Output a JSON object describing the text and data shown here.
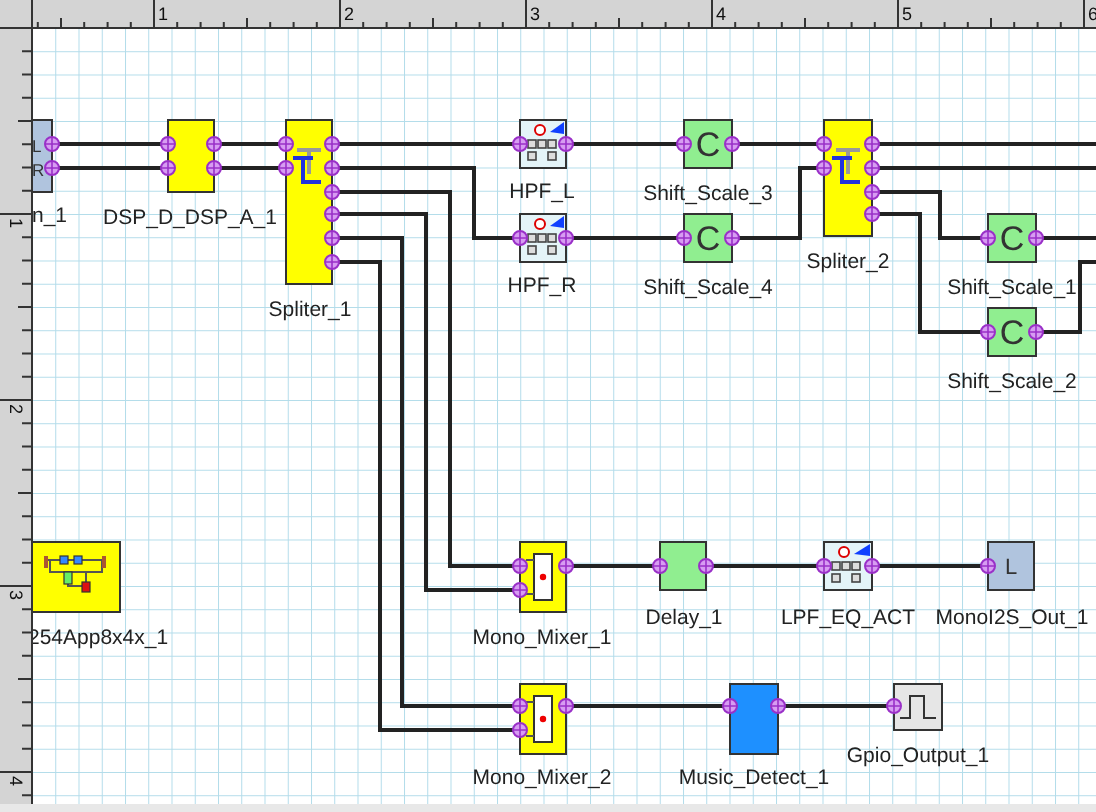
{
  "rulers": {
    "top_labels": [
      "1",
      "2",
      "3",
      "4",
      "5",
      "6"
    ],
    "left_labels": [
      "1",
      "2",
      "3",
      "4"
    ]
  },
  "blocks": [
    {
      "label": "n_1",
      "kind": "io",
      "glyphs": [
        "L",
        "R"
      ]
    },
    {
      "label": "DSP_D_DSP_A_1",
      "kind": "dsp"
    },
    {
      "label": "Spliter_1",
      "kind": "splitter"
    },
    {
      "label": "HPF_L",
      "kind": "filter"
    },
    {
      "label": "HPF_R",
      "kind": "filter"
    },
    {
      "label": "Shift_Scale_3",
      "kind": "scale",
      "glyphs": [
        "C"
      ]
    },
    {
      "label": "Shift_Scale_4",
      "kind": "scale",
      "glyphs": [
        "C"
      ]
    },
    {
      "label": "Spliter_2",
      "kind": "splitter"
    },
    {
      "label": "Shift_Scale_1",
      "kind": "scale",
      "glyphs": [
        "C"
      ]
    },
    {
      "label": "Shift_Scale_2",
      "kind": "scale",
      "glyphs": [
        "C"
      ]
    },
    {
      "label": "254App8x4x_1",
      "kind": "app"
    },
    {
      "label": "Mono_Mixer_1",
      "kind": "mixer"
    },
    {
      "label": "Mono_Mixer_2",
      "kind": "mixer"
    },
    {
      "label": "Delay_1",
      "kind": "delay"
    },
    {
      "label": "LPF_EQ_ACT",
      "kind": "filter"
    },
    {
      "label": "MonoI2S_Out_1",
      "kind": "io",
      "glyphs": [
        "L"
      ]
    },
    {
      "label": "Music_Detect_1",
      "kind": "detector"
    },
    {
      "label": "Gpio_Output_1",
      "kind": "gpio"
    }
  ]
}
